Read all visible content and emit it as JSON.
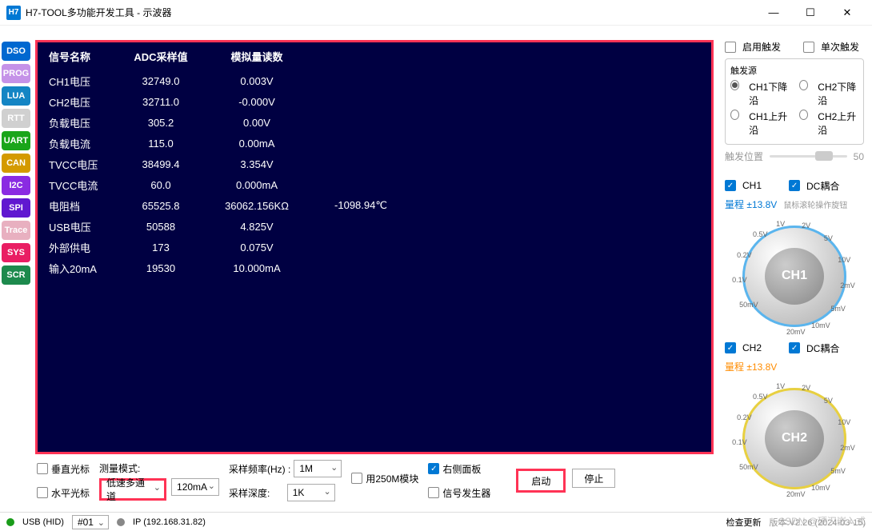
{
  "window": {
    "icon": "H7",
    "title": "H7-TOOL多功能开发工具 - 示波器"
  },
  "sidebar": [
    {
      "label": "DSO",
      "bg": "#0068d0"
    },
    {
      "label": "PROG",
      "bg": "#c592e8"
    },
    {
      "label": "LUA",
      "bg": "#1485c4"
    },
    {
      "label": "RTT",
      "bg": "#d0d0d0"
    },
    {
      "label": "UART",
      "bg": "#1aa51a"
    },
    {
      "label": "CAN",
      "bg": "#d49a00"
    },
    {
      "label": "I2C",
      "bg": "#8a2be2"
    },
    {
      "label": "SPI",
      "bg": "#6018d0"
    },
    {
      "label": "Trace",
      "bg": "#e8b0c0"
    },
    {
      "label": "SYS",
      "bg": "#e91e63"
    },
    {
      "label": "SCR",
      "bg": "#1d8a4d"
    }
  ],
  "scope_header": {
    "c1": "信号名称",
    "c2": "ADC采样值",
    "c3": "模拟量读数"
  },
  "scope_rows": [
    {
      "name": "CH1电压",
      "adc": "32749.0",
      "val": "0.003V",
      "extra": ""
    },
    {
      "name": "CH2电压",
      "adc": "32711.0",
      "val": "-0.000V",
      "extra": ""
    },
    {
      "name": "负载电压",
      "adc": "305.2",
      "val": "0.00V",
      "extra": ""
    },
    {
      "name": "负载电流",
      "adc": "115.0",
      "val": "0.00mA",
      "extra": ""
    },
    {
      "name": "TVCC电压",
      "adc": "38499.4",
      "val": "3.354V",
      "extra": ""
    },
    {
      "name": "TVCC电流",
      "adc": "60.0",
      "val": "0.000mA",
      "extra": ""
    },
    {
      "name": "电阻档",
      "adc": "65525.8",
      "val": "36062.156KΩ",
      "extra": "-1098.94℃"
    },
    {
      "name": "USB电压",
      "adc": "50588",
      "val": "4.825V",
      "extra": ""
    },
    {
      "name": "外部供电",
      "adc": "173",
      "val": "0.075V",
      "extra": ""
    },
    {
      "name": "输入20mA",
      "adc": "19530",
      "val": "10.000mA",
      "extra": ""
    }
  ],
  "bottom": {
    "vcursor": "垂直光标",
    "hcursor": "水平光标",
    "measure_mode_label": "测量模式:",
    "measure_mode_value": "低速多通道",
    "range_value": "120mA",
    "sample_rate_label": "采样频率(Hz) :",
    "sample_rate_value": "1M",
    "sample_depth_label": "采样深度:",
    "sample_depth_value": "1K",
    "use250m": "用250M模块",
    "rightpanel": "右侧面板",
    "siggen": "信号发生器",
    "start": "启动",
    "stop": "停止"
  },
  "right": {
    "enable_trigger": "启用触发",
    "single_trigger": "单次触发",
    "trigger_src": "触发源",
    "ch1_fall": "CH1下降沿",
    "ch2_fall": "CH2下降沿",
    "ch1_rise": "CH1上升沿",
    "ch2_rise": "CH2上升沿",
    "trigger_pos": "触发位置",
    "trigger_pos_val": "50",
    "ch1": "CH1",
    "ch2": "CH2",
    "dc_couple": "DC耦合",
    "range_label": "量程",
    "range_val": "±13.8V",
    "hint": "鼠标滚轮操作旋钮",
    "dial_ticks": [
      "50mV",
      "0.1V",
      "0.2V",
      "0.5V",
      "1V",
      "2V",
      "5V",
      "10V",
      "2mV",
      "5mV",
      "10mV",
      "20mV"
    ]
  },
  "status": {
    "usb": "USB (HID)",
    "ch": "#01",
    "ip": "IP (192.168.31.82)",
    "check_update": "检查更新",
    "version": "版本:V2.26 (2024-03-15)"
  },
  "watermark": "CSDN @硬汉嵌入式"
}
